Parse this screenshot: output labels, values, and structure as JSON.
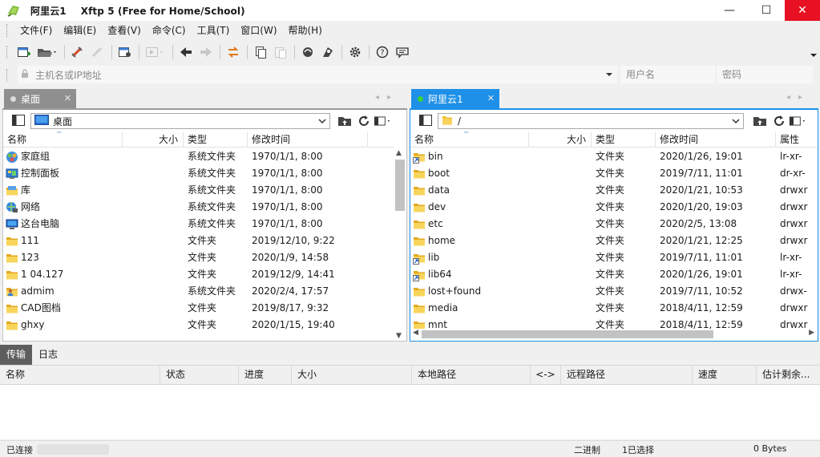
{
  "window": {
    "session_name": "阿里云1",
    "app_title": "Xftp 5 (Free for Home/School)",
    "minimize": "—",
    "maximize": "☐",
    "close": "✕"
  },
  "menu": [
    "文件(F)",
    "编辑(E)",
    "查看(V)",
    "命令(C)",
    "工具(T)",
    "窗口(W)",
    "帮助(H)"
  ],
  "address": {
    "host_placeholder": "主机名或IP地址",
    "user_placeholder": "用户名",
    "password_placeholder": "密码"
  },
  "left_pane": {
    "tab_label": "桌面",
    "path": "桌面",
    "columns": [
      "名称",
      "大小",
      "类型",
      "修改时间"
    ],
    "rows": [
      {
        "name": "家庭组",
        "size": "",
        "type": "系统文件夹",
        "modified": "1970/1/1, 8:00",
        "icon": "homegroup-icon"
      },
      {
        "name": "控制面板",
        "size": "",
        "type": "系统文件夹",
        "modified": "1970/1/1, 8:00",
        "icon": "control-panel-icon"
      },
      {
        "name": "库",
        "size": "",
        "type": "系统文件夹",
        "modified": "1970/1/1, 8:00",
        "icon": "library-icon"
      },
      {
        "name": "网络",
        "size": "",
        "type": "系统文件夹",
        "modified": "1970/1/1, 8:00",
        "icon": "network-icon"
      },
      {
        "name": "这台电脑",
        "size": "",
        "type": "系统文件夹",
        "modified": "1970/1/1, 8:00",
        "icon": "computer-icon"
      },
      {
        "name": "111",
        "size": "",
        "type": "文件夹",
        "modified": "2019/12/10, 9:22",
        "icon": "folder-icon"
      },
      {
        "name": "123",
        "size": "",
        "type": "文件夹",
        "modified": "2020/1/9, 14:58",
        "icon": "folder-icon"
      },
      {
        "name": "1                04.127",
        "size": "",
        "type": "文件夹",
        "modified": "2019/12/9, 14:41",
        "icon": "folder-icon"
      },
      {
        "name": "admim",
        "size": "",
        "type": "系统文件夹",
        "modified": "2020/2/4, 17:57",
        "icon": "user-folder-icon"
      },
      {
        "name": "CAD图档",
        "size": "",
        "type": "文件夹",
        "modified": "2019/8/17, 9:32",
        "icon": "folder-icon"
      },
      {
        "name": "ghxy",
        "size": "",
        "type": "文件夹",
        "modified": "2020/1/15, 19:40",
        "icon": "folder-icon"
      }
    ]
  },
  "right_pane": {
    "tab_label": "阿里云1",
    "path": "/",
    "columns": [
      "名称",
      "大小",
      "类型",
      "修改时间",
      "属性"
    ],
    "rows": [
      {
        "name": "bin",
        "size": "",
        "type": "文件夹",
        "modified": "2020/1/26, 19:01",
        "attr": "lr-xr-",
        "icon": "folder-link-icon"
      },
      {
        "name": "boot",
        "size": "",
        "type": "文件夹",
        "modified": "2019/7/11, 11:01",
        "attr": "dr-xr-",
        "icon": "folder-icon"
      },
      {
        "name": "data",
        "size": "",
        "type": "文件夹",
        "modified": "2020/1/21, 10:53",
        "attr": "drwxr",
        "icon": "folder-icon"
      },
      {
        "name": "dev",
        "size": "",
        "type": "文件夹",
        "modified": "2020/1/20, 19:03",
        "attr": "drwxr",
        "icon": "folder-icon"
      },
      {
        "name": "etc",
        "size": "",
        "type": "文件夹",
        "modified": "2020/2/5, 13:08",
        "attr": "drwxr",
        "icon": "folder-icon"
      },
      {
        "name": "home",
        "size": "",
        "type": "文件夹",
        "modified": "2020/1/21, 12:25",
        "attr": "drwxr",
        "icon": "folder-icon"
      },
      {
        "name": "lib",
        "size": "",
        "type": "文件夹",
        "modified": "2019/7/11, 11:01",
        "attr": "lr-xr-",
        "icon": "folder-link-icon"
      },
      {
        "name": "lib64",
        "size": "",
        "type": "文件夹",
        "modified": "2020/1/26, 19:01",
        "attr": "lr-xr-",
        "icon": "folder-link-icon"
      },
      {
        "name": "lost+found",
        "size": "",
        "type": "文件夹",
        "modified": "2019/7/11, 10:52",
        "attr": "drwx-",
        "icon": "folder-icon"
      },
      {
        "name": "media",
        "size": "",
        "type": "文件夹",
        "modified": "2018/4/11, 12:59",
        "attr": "drwxr",
        "icon": "folder-icon"
      },
      {
        "name": "mnt",
        "size": "",
        "type": "文件夹",
        "modified": "2018/4/11, 12:59",
        "attr": "drwxr",
        "icon": "folder-icon"
      }
    ]
  },
  "transfer": {
    "tabs": [
      "传输",
      "日志"
    ],
    "columns": [
      "名称",
      "状态",
      "进度",
      "大小",
      "本地路径",
      "<->",
      "远程路径",
      "速度",
      "估计剩余..."
    ]
  },
  "status": {
    "connection": "已连接",
    "mode": "二进制",
    "selected": "1已选择",
    "bytes": "0 Bytes"
  },
  "colors": {
    "accent": "#1e90e8",
    "close_red": "#e81123",
    "folder_yellow": "#f2c230"
  }
}
